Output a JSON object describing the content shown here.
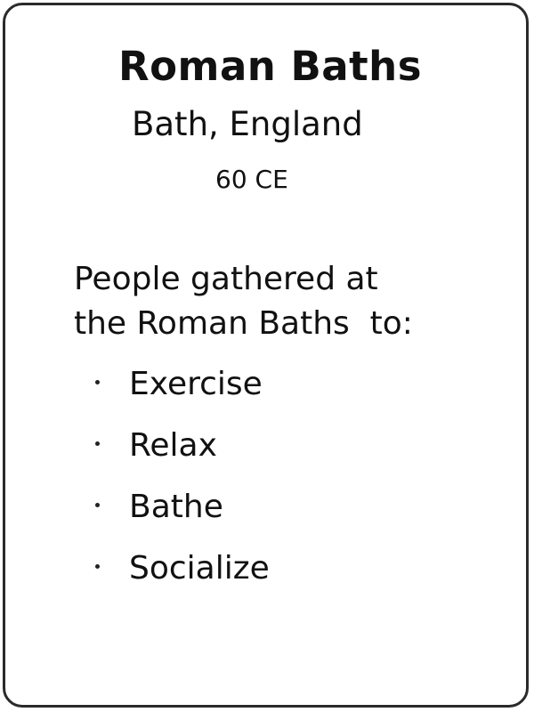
{
  "card": {
    "title": "Roman Baths",
    "location": "Bath, England",
    "date": "60 CE",
    "intro_lines": [
      "People gathered at",
      "the Roman Baths  to:"
    ],
    "activities": [
      "Exercise",
      "Relax",
      "Bathe",
      "Socialize"
    ]
  }
}
